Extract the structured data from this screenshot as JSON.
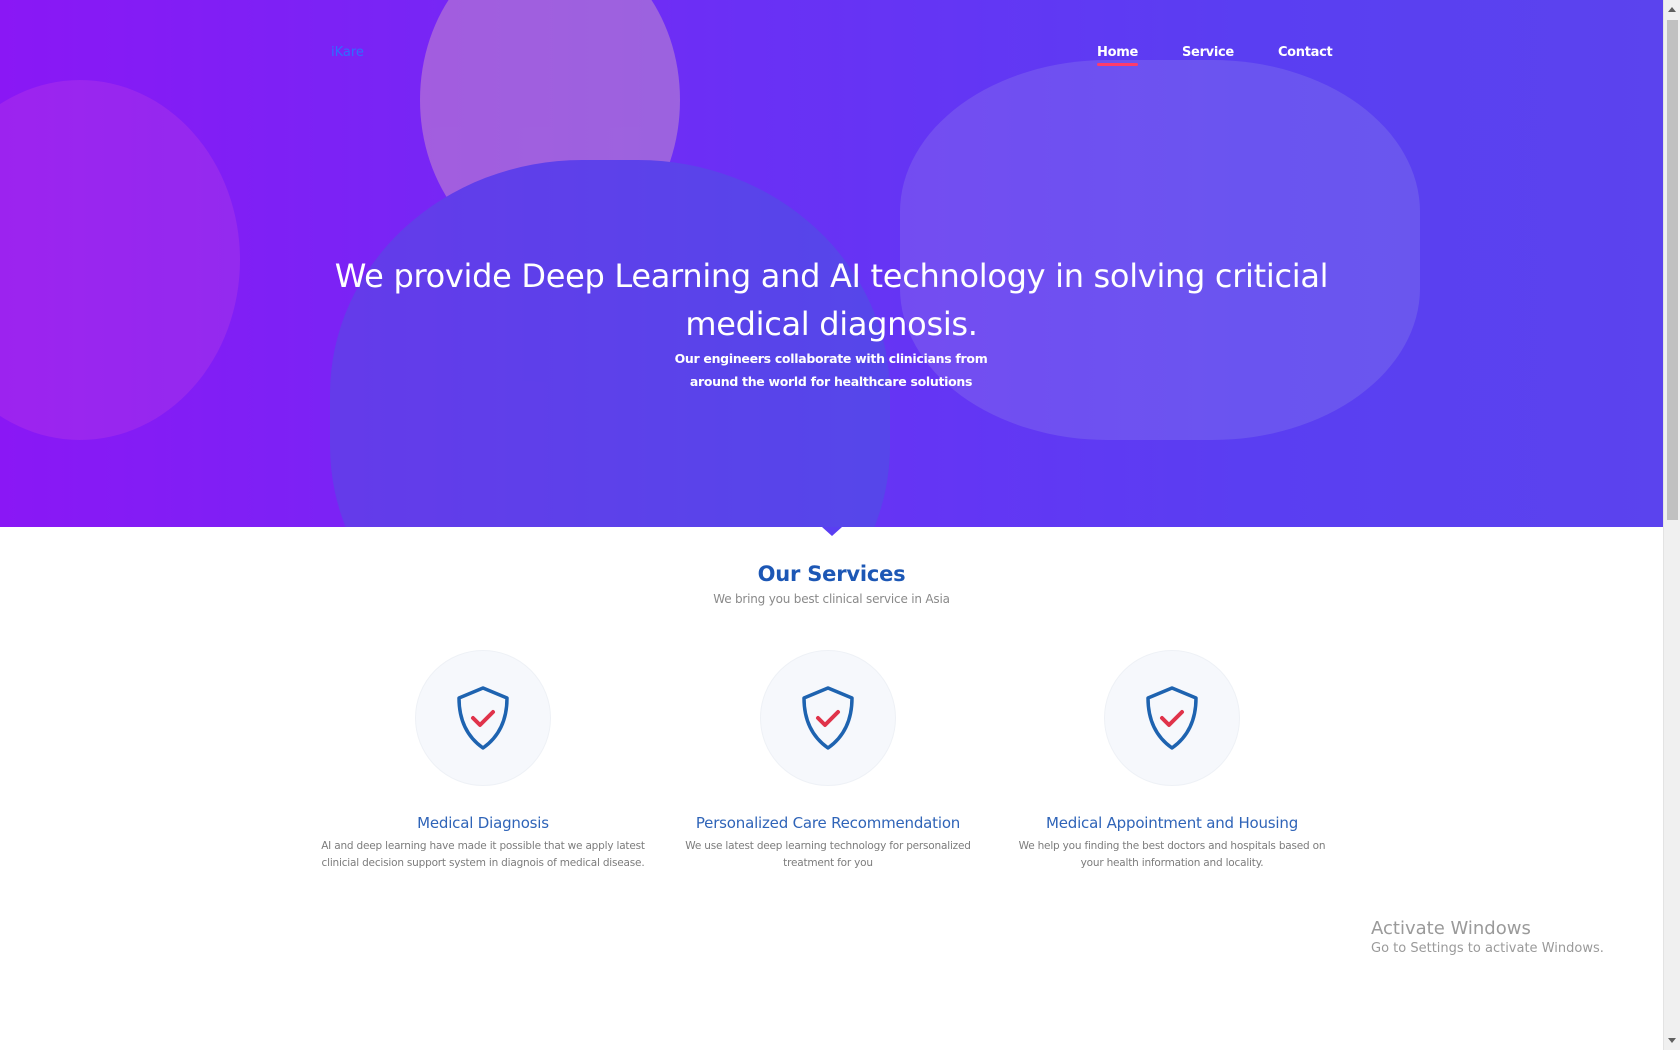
{
  "nav": {
    "brand": "iKare",
    "links": [
      {
        "label": "Home",
        "active": true
      },
      {
        "label": "Service",
        "active": false
      },
      {
        "label": "Contact",
        "active": false
      }
    ]
  },
  "hero": {
    "title": "We provide Deep Learning and AI technology in solving criticial medical diagnosis.",
    "subtitle": "Our engineers collaborate with clinicians from around the world for healthcare solutions"
  },
  "services": {
    "title": "Our Services",
    "subtitle": "We bring you best clinical service in Asia",
    "items": [
      {
        "icon": "shield-check-icon",
        "title": "Medical Diagnosis",
        "text": "AI and deep learning have made it possible that we apply latest clinicial decision support system in diagnois of medical disease."
      },
      {
        "icon": "shield-check-icon",
        "title": "Personalized Care Recommendation",
        "text": "We use latest deep learning technology for personalized treatment for you"
      },
      {
        "icon": "shield-check-icon",
        "title": "Medical Appointment and Housing",
        "text": "We help you finding the best doctors and hospitals based on your health information and locality."
      }
    ]
  },
  "watermark": {
    "title": "Activate Windows",
    "subtitle": "Go to Settings to activate Windows."
  },
  "colors": {
    "hero_gradient_start": "#8a17f5",
    "hero_gradient_end": "#5b43ee",
    "accent_underline": "#ff3b6b",
    "shield_blue": "#1e63b0",
    "check_red": "#e0334a",
    "title_blue": "#1c57b5"
  }
}
